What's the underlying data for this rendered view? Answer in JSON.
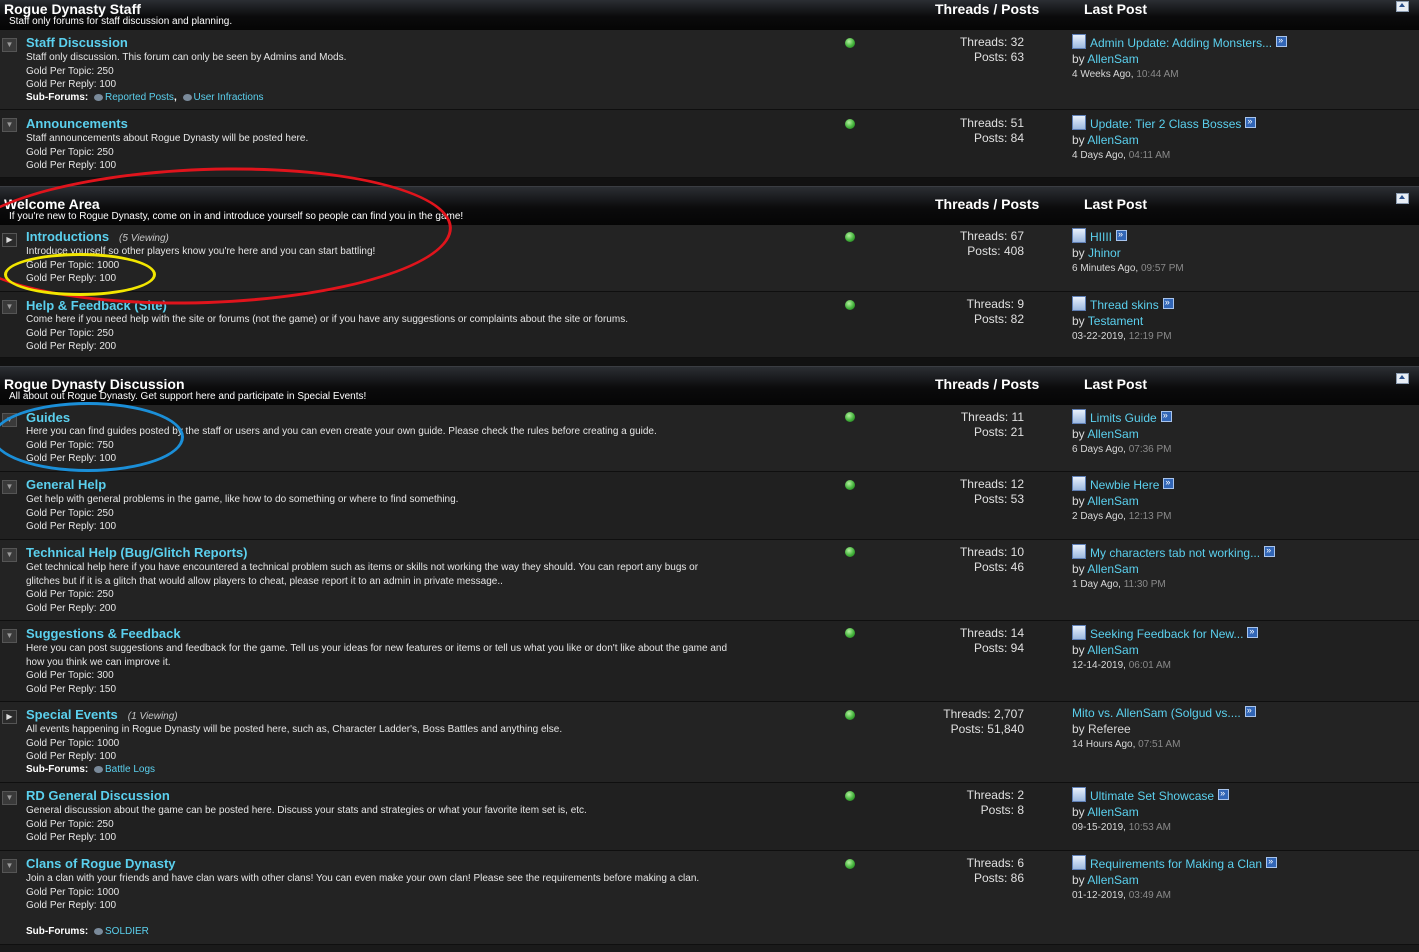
{
  "headers": {
    "threads_posts": "Threads / Posts",
    "last_post": "Last Post"
  },
  "labels": {
    "subforums": "Sub-Forums:"
  },
  "categories": [
    {
      "title": "Rogue Dynasty Staff",
      "desc": "Staff only forums for staff discussion and planning.",
      "forums": [
        {
          "title": "Staff Discussion",
          "viewing": "",
          "desc": "Staff only discussion. This forum can only be seen by Admins and Mods.",
          "gpt": "Gold Per Topic: 250",
          "gpr": "Gold Per Reply: 100",
          "subforums": [
            "Reported Posts",
            "User Infractions"
          ],
          "threads": "Threads: 32",
          "posts": "Posts: 63",
          "lp_title": "Admin Update: Adding Monsters...",
          "lp_by": "by ",
          "lp_user": "AllenSam",
          "lp_date": "4 Weeks Ago,",
          "lp_time": "10:44 AM"
        },
        {
          "title": "Announcements",
          "viewing": "",
          "desc": "Staff announcements about Rogue Dynasty will be posted here.",
          "gpt": "Gold Per Topic: 250",
          "gpr": "Gold Per Reply: 100",
          "subforums": [],
          "threads": "Threads: 51",
          "posts": "Posts: 84",
          "lp_title": "Update: Tier 2 Class Bosses",
          "lp_by": "by ",
          "lp_user": "AllenSam",
          "lp_date": "4 Days Ago,",
          "lp_time": "04:11 AM"
        }
      ]
    },
    {
      "title": "Welcome Area",
      "desc": "If you're new to Rogue Dynasty, come on in and introduce yourself so people can find you in the game!",
      "forums": [
        {
          "title": "Introductions",
          "viewing": "(5 Viewing)",
          "desc": "Introduce yourself so other players know you're here and you can start battling!",
          "gpt": "Gold Per Topic: 1000",
          "gpr": "Gold Per Reply: 100",
          "subforums": [],
          "threads": "Threads: 67",
          "posts": "Posts: 408",
          "lp_title": "HIIII",
          "lp_by": "by ",
          "lp_user": "Jhinor",
          "lp_date": "6 Minutes Ago,",
          "lp_time": "09:57 PM"
        },
        {
          "title": "Help & Feedback (Site)",
          "viewing": "",
          "desc": "Come here if you need help with the site or forums (not the game) or if you have any suggestions or complaints about the site or forums.",
          "gpt": "Gold Per Topic: 250",
          "gpr": "Gold Per Reply: 200",
          "subforums": [],
          "threads": "Threads: 9",
          "posts": "Posts: 82",
          "lp_title": "Thread skins",
          "lp_by": "by ",
          "lp_user": "Testament",
          "lp_date": "03-22-2019,",
          "lp_time": "12:19 PM"
        }
      ]
    },
    {
      "title": "Rogue Dynasty Discussion",
      "desc": "All about out Rogue Dynasty. Get support here and participate in Special Events!",
      "forums": [
        {
          "title": "Guides",
          "viewing": "",
          "desc": "Here you can find guides posted by the staff or users and you can even create your own guide. Please check the rules before creating a guide.",
          "gpt": "Gold Per Topic: 750",
          "gpr": "Gold Per Reply: 100",
          "subforums": [],
          "threads": "Threads: 11",
          "posts": "Posts: 21",
          "lp_title": "Limits Guide",
          "lp_by": "by ",
          "lp_user": "AllenSam",
          "lp_date": "6 Days Ago,",
          "lp_time": "07:36 PM"
        },
        {
          "title": "General Help",
          "viewing": "",
          "desc": "Get help with general problems in the game, like how to do something or where to find something.",
          "gpt": "Gold Per Topic: 250",
          "gpr": "Gold Per Reply: 100",
          "subforums": [],
          "threads": "Threads: 12",
          "posts": "Posts: 53",
          "lp_title": "Newbie Here",
          "lp_by": "by ",
          "lp_user": "AllenSam",
          "lp_date": "2 Days Ago,",
          "lp_time": "12:13 PM"
        },
        {
          "title": "Technical Help (Bug/Glitch Reports)",
          "viewing": "",
          "desc": "Get technical help here if you have encountered a technical problem such as items or skills not working the way they should. You can report any bugs or glitches but if it is a glitch that would allow players to cheat, please report it to an admin in private message..",
          "gpt": "Gold Per Topic: 250",
          "gpr": "Gold Per Reply: 200",
          "subforums": [],
          "threads": "Threads: 10",
          "posts": "Posts: 46",
          "lp_title": "My characters tab not working...",
          "lp_by": "by ",
          "lp_user": "AllenSam",
          "lp_date": "1 Day Ago,",
          "lp_time": "11:30 PM"
        },
        {
          "title": "Suggestions & Feedback",
          "viewing": "",
          "desc": "Here you can post suggestions and feedback for the game. Tell us your ideas for new features or items or tell us what you like or don't like about the game and how you think we can improve it.",
          "gpt": "Gold Per Topic: 300",
          "gpr": "Gold Per Reply: 150",
          "subforums": [],
          "threads": "Threads: 14",
          "posts": "Posts: 94",
          "lp_title": "Seeking Feedback for New...",
          "lp_by": "by ",
          "lp_user": "AllenSam",
          "lp_date": "12-14-2019,",
          "lp_time": "06:01 AM"
        },
        {
          "title": "Special Events",
          "viewing": "(1 Viewing)",
          "desc": "All events happening in Rogue Dynasty will be posted here, such as, Character Ladder's, Boss Battles and anything else.",
          "gpt": "Gold Per Topic: 1000",
          "gpr": "Gold Per Reply: 100",
          "subforums": [
            "Battle Logs"
          ],
          "threads": "Threads: 2,707",
          "posts": "Posts: 51,840",
          "lp_title": "Mito vs. AllenSam (Solgud vs....",
          "lp_by": "by Referee",
          "lp_user": "",
          "lp_date": "14 Hours Ago,",
          "lp_time": "07:51 AM"
        },
        {
          "title": "RD General Discussion",
          "viewing": "",
          "desc": "General discussion about the game can be posted here. Discuss your stats and strategies or what your favorite item set is, etc.",
          "gpt": "Gold Per Topic: 250",
          "gpr": "Gold Per Reply: 100",
          "subforums": [],
          "threads": "Threads: 2",
          "posts": "Posts: 8",
          "lp_title": "Ultimate Set Showcase",
          "lp_by": "by ",
          "lp_user": "AllenSam",
          "lp_date": "09-15-2019,",
          "lp_time": "10:53 AM"
        },
        {
          "title": "Clans of Rogue Dynasty",
          "viewing": "",
          "desc": "Join a clan with your friends and have clan wars with other clans! You can even make your own clan! Please see the requirements before making a clan.",
          "gpt": "Gold Per Topic: 1000",
          "gpr": "Gold Per Reply: 100",
          "subforums": [
            "SOLDIER"
          ],
          "threads": "Threads: 6",
          "posts": "Posts: 86",
          "lp_title": "Requirements for Making a Clan",
          "lp_by": "by ",
          "lp_user": "AllenSam",
          "lp_date": "01-12-2019,",
          "lp_time": "03:49 AM"
        }
      ]
    }
  ],
  "annotations": {
    "red": "#e0141c",
    "yellow": "#f2e600",
    "blue": "#1b8fd8"
  }
}
